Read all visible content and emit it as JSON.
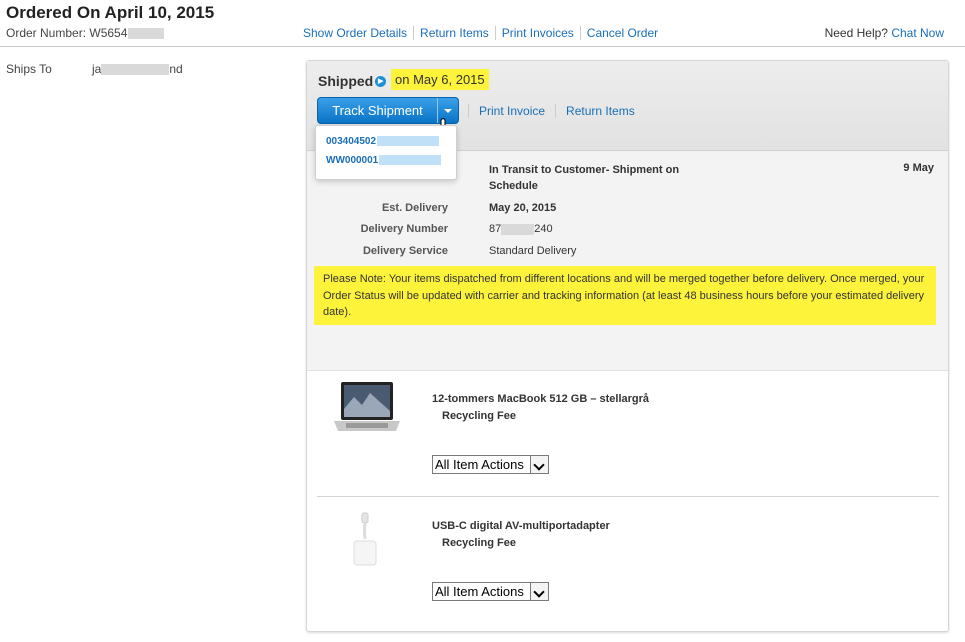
{
  "order": {
    "title": "Ordered On April 10, 2015",
    "number_label": "Order Number:",
    "number_prefix": "W5654"
  },
  "top_links": [
    "Show Order Details",
    "Return Items",
    "Print Invoices",
    "Cancel Order"
  ],
  "help": {
    "text": "Need Help?",
    "link": "Chat Now"
  },
  "ships_to": {
    "label": "Ships To",
    "name_start": "ja",
    "name_end": "nd"
  },
  "shipment": {
    "status": "Shipped",
    "date_prefix": "on",
    "date": "May 6, 2015",
    "track_label": "Track Shipment",
    "links": [
      "Print Invoice",
      "Return Items"
    ],
    "tracking_numbers": [
      "003404502",
      "WW000001"
    ],
    "transit_status": "In Transit to Customer- Shipment on Schedule",
    "transit_date": "9 May",
    "details": [
      {
        "label": "Est. Delivery",
        "value": "May 20, 2015"
      },
      {
        "label": "Delivery Number",
        "value_start": "87",
        "value_end": "240"
      },
      {
        "label": "Delivery Service",
        "value": "Standard Delivery"
      }
    ],
    "note": "Please Note: Your items dispatched from different locations and will be merged together before delivery. Once merged, your Order Status will be updated with carrier and tracking information (at least 48 business hours before your estimated delivery date)."
  },
  "items": [
    {
      "title": "12-tommers MacBook 512 GB – stellargrå",
      "fee": "Recycling Fee",
      "action": "All Item Actions"
    },
    {
      "title": "USB-C digital AV-multiportadapter",
      "fee": "Recycling Fee",
      "action": "All Item Actions"
    }
  ],
  "colors": {
    "link": "#1a6fb8",
    "highlight": "#fcf33a",
    "button": "#0a73c6"
  }
}
